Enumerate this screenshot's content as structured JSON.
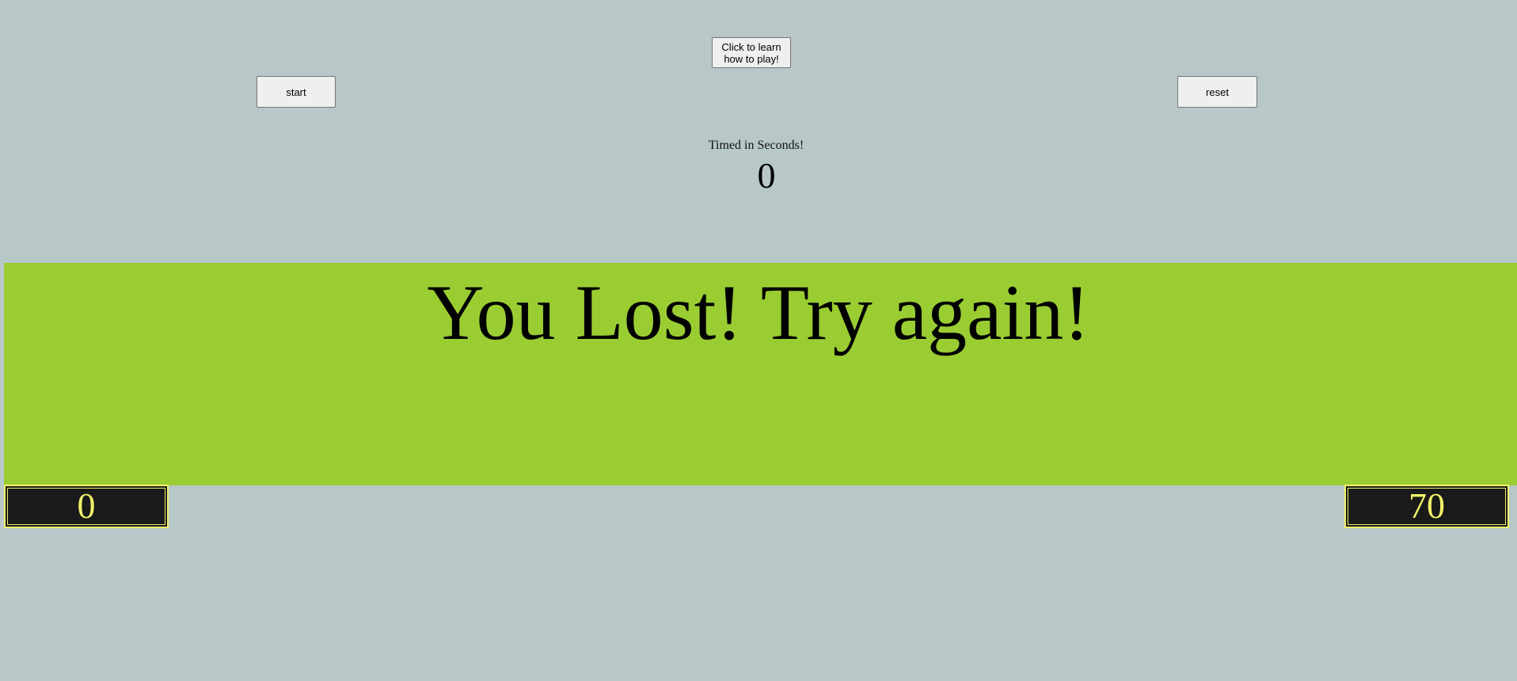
{
  "controls": {
    "help_label": "Click to learn how to play!",
    "start_label": "start",
    "reset_label": "reset"
  },
  "timer": {
    "label": "Timed in Seconds!",
    "value": "0"
  },
  "message": {
    "text": "You Lost! Try again!"
  },
  "scores": {
    "left": "0",
    "right": "70"
  },
  "colors": {
    "background": "#b8c7c7",
    "message_band": "#9acd32",
    "score_box_bg": "#1a1a1a",
    "score_text": "#f0f06a"
  }
}
